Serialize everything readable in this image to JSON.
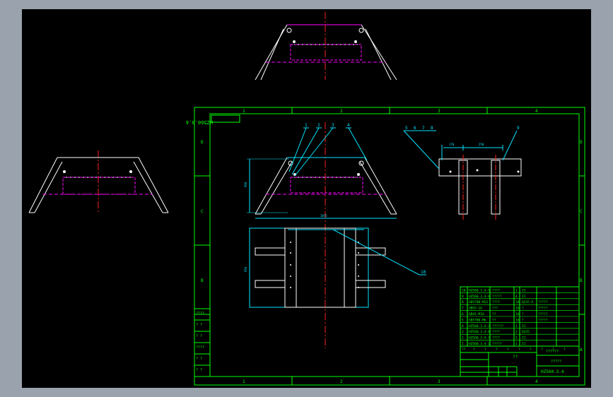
{
  "drawing": {
    "drawing_number": "HZ560.3.4",
    "drawing_number_rotated": "HZ560.3.4",
    "title_block": {
      "company": "??????",
      "name": "?????",
      "scale_mark": "??"
    }
  },
  "frame": {
    "columns_top": [
      "1",
      "2",
      "3",
      "4"
    ],
    "columns_bottom": [
      "1",
      "2",
      "3",
      "4"
    ],
    "rows_left": [
      "D",
      "C",
      "B",
      "A"
    ],
    "rows_right": [
      "D",
      "C",
      "B",
      "A"
    ]
  },
  "left_side_table": {
    "rows": [
      "????",
      "? ?",
      "? ?",
      "????",
      "? ?",
      "? ?"
    ]
  },
  "callouts": {
    "front_view": [
      "1",
      "2",
      "3",
      "4"
    ],
    "side_view": [
      "5",
      "6",
      "7",
      "8"
    ],
    "side_view_right": "9",
    "plan_view": "10"
  },
  "dimensions": {
    "height": "990",
    "width": "1875",
    "plan_height": "950",
    "side_left": "170",
    "side_right": "250"
  },
  "bom": {
    "rows": [
      {
        "no": "10",
        "code": "HZ560.3.4-5",
        "name": "????",
        "qty": "1",
        "mat": "Z1",
        "extra": ""
      },
      {
        "no": "9",
        "code": "HZ560.3.4-6",
        "name": "?????",
        "qty": "4",
        "mat": "Z1",
        "extra": ""
      },
      {
        "no": "8",
        "code": "GB5780-M12",
        "name": "????",
        "qty": "16",
        "mat": "Q235-A",
        "extra": "?????"
      },
      {
        "no": "7",
        "code": "GB93-16",
        "name": "???",
        "qty": "16",
        "mat": "?",
        "extra": "?????"
      },
      {
        "no": "6",
        "code": "GB41-M16",
        "name": "??",
        "qty": "16",
        "mat": "?",
        "extra": "?????"
      },
      {
        "no": "5",
        "code": "GB5780-M6",
        "name": "??",
        "qty": "16",
        "mat": "?",
        "extra": "?????"
      },
      {
        "no": "4",
        "code": "HZ560.3.4-2",
        "name": "??????",
        "qty": "1",
        "mat": "Z1",
        "extra": ""
      },
      {
        "no": "3",
        "code": "HZ560.3.4-4",
        "name": "????",
        "qty": "2",
        "mat": "Q235",
        "extra": ""
      },
      {
        "no": "2",
        "code": "HZ560.3.4-3",
        "name": "????",
        "qty": "2",
        "mat": "Z1",
        "extra": ""
      },
      {
        "no": "1",
        "code": "HZ560.3.4-1",
        "name": "?????",
        "qty": "1",
        "mat": "Z1",
        "extra": ""
      }
    ],
    "header": [
      "??",
      "?",
      "?",
      "?",
      "?",
      "?",
      "?",
      "?",
      "?",
      "?"
    ]
  },
  "colors": {
    "background": "#000000",
    "frame": "#00ff00",
    "outline": "#ffffff",
    "centerline": "#ff2020",
    "hidden": "#ff00ff",
    "dimension": "#00e5ff",
    "weld": "#ffff00"
  }
}
